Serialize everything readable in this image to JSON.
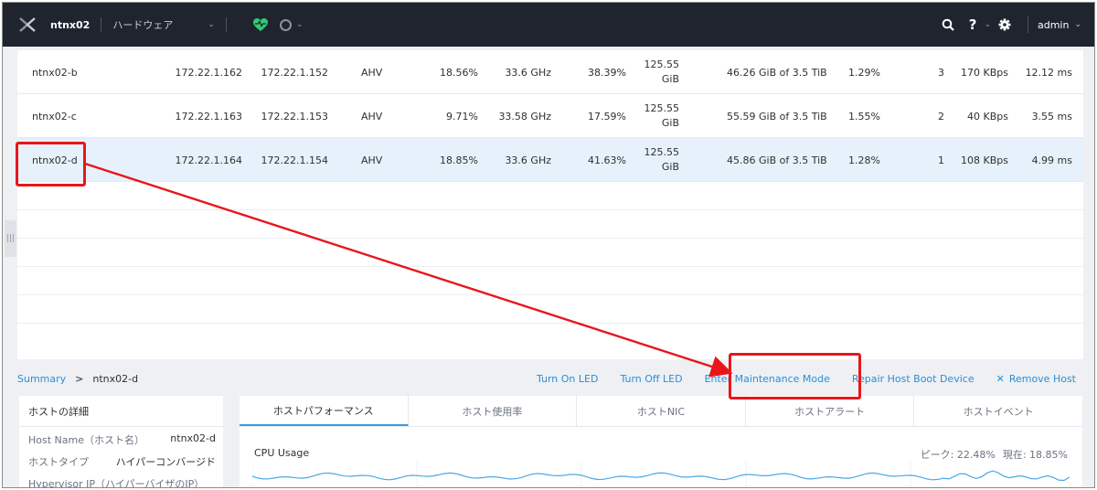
{
  "topbar": {
    "cluster_name": "ntnx02",
    "menu_label": "ハードウェア",
    "caret": "⌄",
    "help": "?",
    "user": "admin"
  },
  "table": {
    "rows": [
      {
        "name": "ntnx02-b",
        "host_ip": "172.22.1.162",
        "cvm_ip": "172.22.1.152",
        "hypervisor": "AHV",
        "cpu_usage": "18.56%",
        "cpu_capacity": "33.6 GHz",
        "mem_usage": "38.39%",
        "mem_capacity_1": "125.55",
        "mem_capacity_2": "GiB",
        "storage": "46.26 GiB of 3.5 TiB",
        "disk_usage": "1.29%",
        "vms": "3",
        "iops": "170 KBps",
        "latency": "12.12 ms"
      },
      {
        "name": "ntnx02-c",
        "host_ip": "172.22.1.163",
        "cvm_ip": "172.22.1.153",
        "hypervisor": "AHV",
        "cpu_usage": "9.71%",
        "cpu_capacity": "33.58 GHz",
        "mem_usage": "17.59%",
        "mem_capacity_1": "125.55",
        "mem_capacity_2": "GiB",
        "storage": "55.59 GiB of 3.5 TiB",
        "disk_usage": "1.55%",
        "vms": "2",
        "iops": "40 KBps",
        "latency": "3.55 ms"
      },
      {
        "name": "ntnx02-d",
        "host_ip": "172.22.1.164",
        "cvm_ip": "172.22.1.154",
        "hypervisor": "AHV",
        "cpu_usage": "18.85%",
        "cpu_capacity": "33.6 GHz",
        "mem_usage": "41.63%",
        "mem_capacity_1": "125.55",
        "mem_capacity_2": "GiB",
        "storage": "45.86 GiB of 3.5 TiB",
        "disk_usage": "1.28%",
        "vms": "1",
        "iops": "108 KBps",
        "latency": "4.99 ms"
      }
    ]
  },
  "breadcrumb": {
    "summary": "Summary",
    "separator": ">",
    "current": "ntnx02-d"
  },
  "actions": {
    "turn_on_led": "Turn On LED",
    "turn_off_led": "Turn Off LED",
    "enter_maintenance": "Enter Maintenance Mode",
    "repair_boot": "Repair Host Boot Device",
    "remove_host_icon": "✕",
    "remove_host": "Remove Host"
  },
  "details": {
    "title": "ホストの詳細",
    "items": [
      {
        "key": "Host Name（ホスト名）",
        "value": "ntnx02-d"
      },
      {
        "key": "ホストタイプ",
        "value": "ハイパーコンバージド"
      },
      {
        "key": "Hypervisor IP（ハイパーバイザのIP）",
        "value": ""
      }
    ]
  },
  "perf": {
    "tabs": [
      "ホストパフォーマンス",
      "ホスト使用率",
      "ホストNIC",
      "ホストアラート",
      "ホストイベント"
    ],
    "cpu_title": "CPU Usage",
    "peak_label": "ピーク: 22.48%",
    "current_label": "現在: 18.85%"
  },
  "colors": {
    "topbar_bg": "#20242f",
    "accent": "#2a8fd6",
    "health_green": "#2ecc71",
    "selected_row": "#e7f1fb",
    "annotation_red": "#e8161b"
  }
}
